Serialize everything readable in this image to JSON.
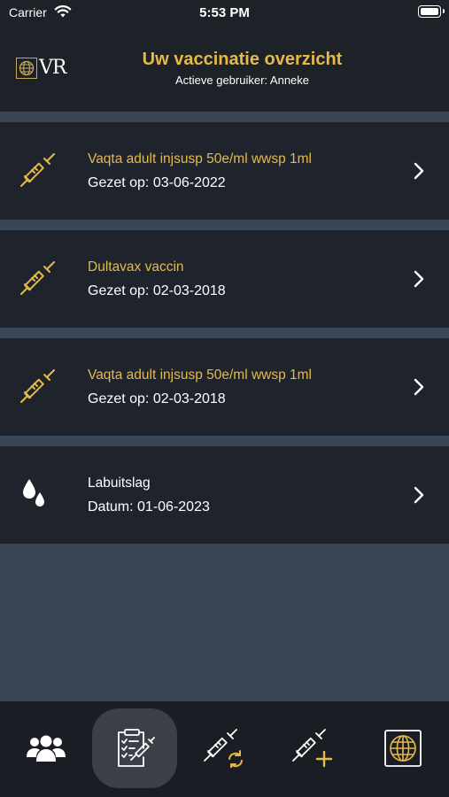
{
  "status_bar": {
    "carrier": "Carrier",
    "time": "5:53 PM"
  },
  "header": {
    "logo_text": "VR",
    "title": "Uw vaccinatie overzicht",
    "subtitle": "Actieve gebruiker: Anneke"
  },
  "items": [
    {
      "icon": "syringe-icon",
      "title": "Vaqta adult injsusp 50e/ml wwsp 1ml",
      "date": "Gezet op: 03-06-2022"
    },
    {
      "icon": "syringe-icon",
      "title": "Dultavax vaccin",
      "date": "Gezet op: 02-03-2018"
    },
    {
      "icon": "syringe-icon",
      "title": "Vaqta adult injsusp 50e/ml wwsp 1ml",
      "date": "Gezet op: 02-03-2018"
    },
    {
      "icon": "blood-drops-icon",
      "title": "Labuitslag",
      "date": "Datum: 01-06-2023"
    }
  ],
  "tabbar": {
    "tabs": [
      {
        "icon": "users-icon",
        "active": false
      },
      {
        "icon": "vaccination-checklist-icon",
        "active": true
      },
      {
        "icon": "syringe-refresh-icon",
        "active": false
      },
      {
        "icon": "syringe-add-icon",
        "active": false
      },
      {
        "icon": "globe-icon",
        "active": false
      }
    ]
  },
  "colors": {
    "accent": "#e7b94a",
    "background": "#1d2128",
    "list_background": "#3a4555"
  }
}
